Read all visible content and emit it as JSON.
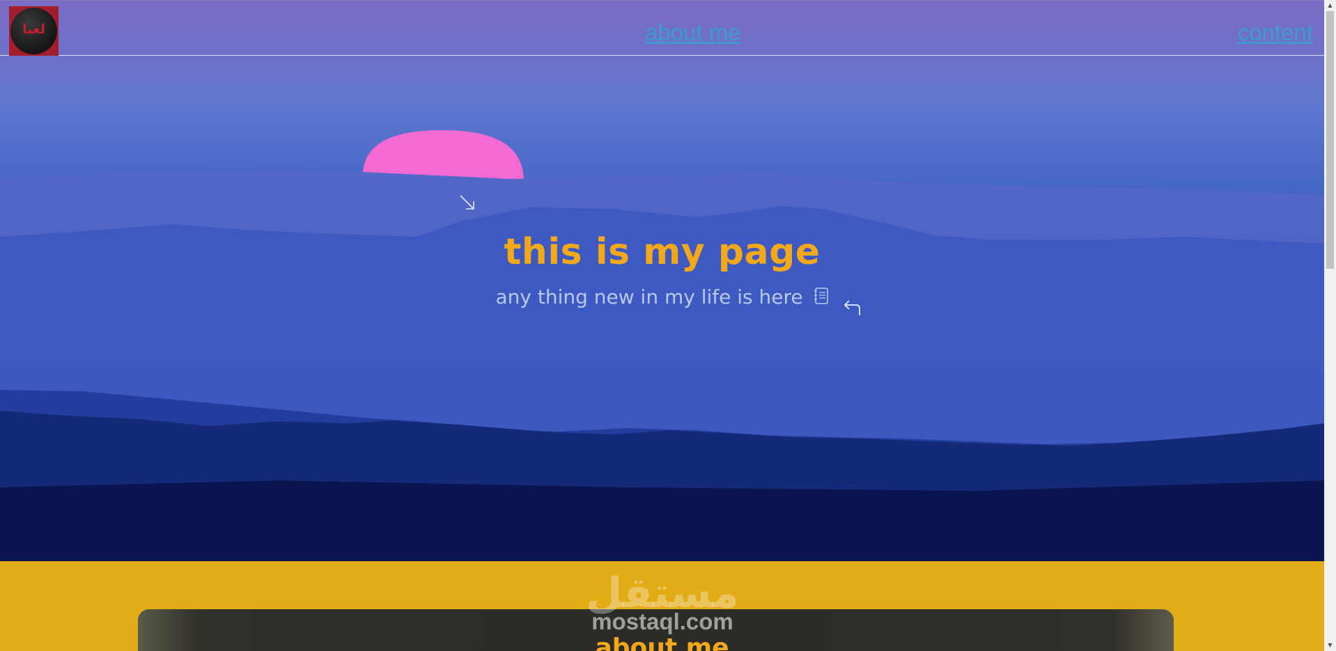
{
  "nav": {
    "logo_text": "لعبا",
    "links": [
      {
        "label": "about me"
      },
      {
        "label": "content"
      }
    ]
  },
  "hero": {
    "title": "this is my page",
    "subtitle": "any thing new in my life is here"
  },
  "watermark": {
    "arabic": "مستقل",
    "url": "mostaql.com"
  },
  "about_section": {
    "title": "about me"
  },
  "colors": {
    "accent": "#f2a817",
    "link": "#3d9bd0",
    "section_bg": "#e2ac16",
    "sun": "#f06ad0"
  },
  "icons": [
    "notebook-icon",
    "arrow-down-right-icon",
    "arrow-return-left-icon"
  ]
}
